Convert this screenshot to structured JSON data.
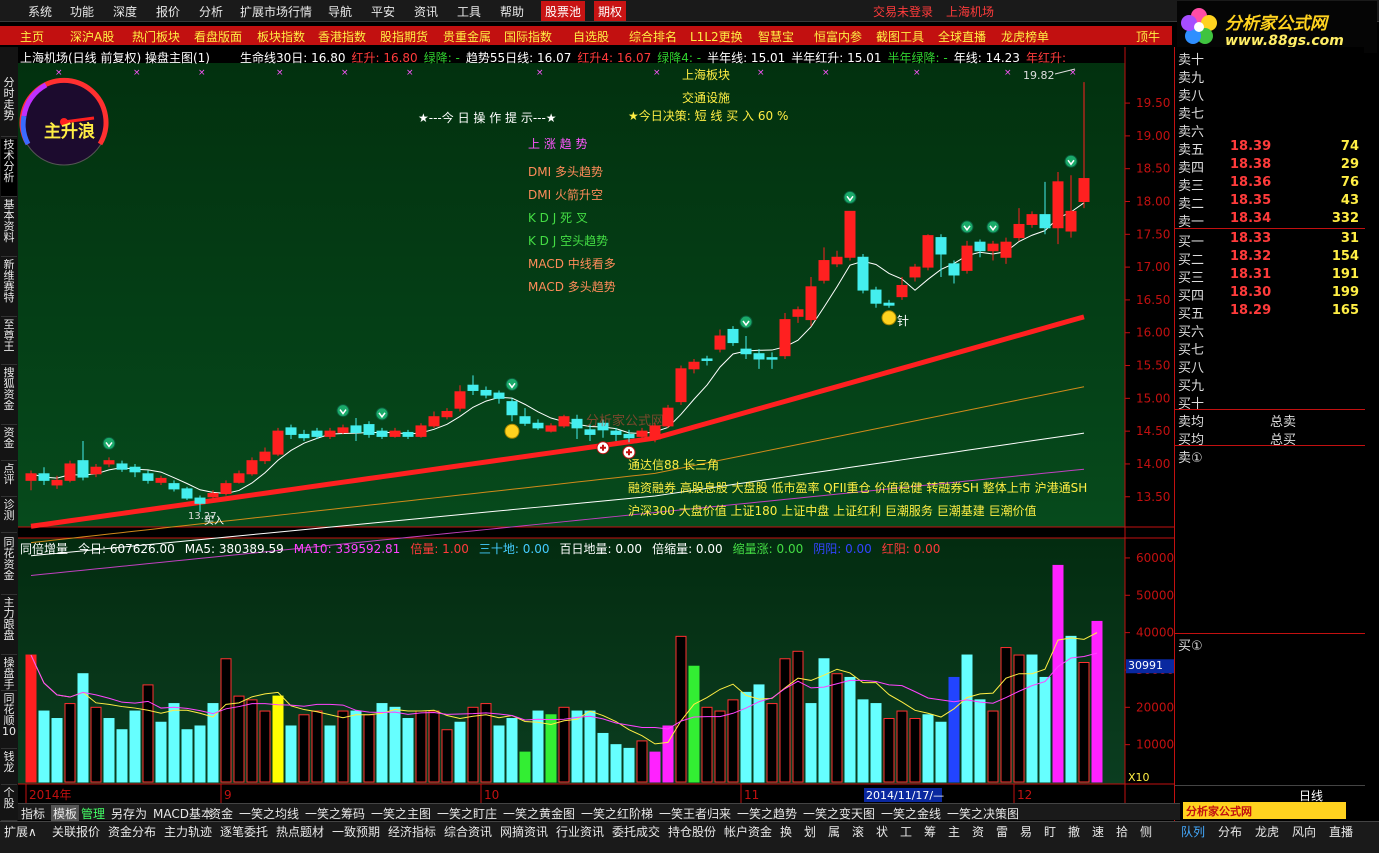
{
  "menu": {
    "items": [
      "系统",
      "功能",
      "深度",
      "报价",
      "分析",
      "扩展市场行情",
      "导航",
      "平安",
      "资讯",
      "工具",
      "帮助"
    ],
    "highlight1": "股票池",
    "highlight2": "期权",
    "status": "交易未登录",
    "stock_name": "上海机场"
  },
  "logo": {
    "line1": "分析家公式网",
    "line2": "www.88gs.com"
  },
  "navbar": {
    "items": [
      "主页",
      "深沪A股",
      "热门板块",
      "看盘版面",
      "板块指数",
      "香港指数",
      "股指期货",
      "贵重金属",
      "国际指数",
      "自选股",
      "综合排名",
      "L1L2更换",
      "智慧宝",
      "恒富内参",
      "截图工具",
      "全球直播",
      "龙虎榜单",
      "顶牛"
    ]
  },
  "left_tabs": [
    "分时走势",
    "技术分析",
    "基本资料",
    "新维赛特",
    "至尊王",
    "搜狐资金",
    "资金",
    "点评",
    "诊测",
    "同花资金",
    "主力跟盘",
    "操盘手",
    "同花顺10",
    "钱龙",
    "个股"
  ],
  "chart_header": {
    "title": "上海机场(日线 前复权) 操盘主图(1)",
    "lines": [
      {
        "label": "生命线30日: 16.80",
        "color": "#ffffff"
      },
      {
        "label": "红升: 16.80",
        "color": "#ff3b3b"
      },
      {
        "label": "绿降: -",
        "color": "#2fd22f"
      },
      {
        "label": "趋势55日线: 16.07",
        "color": "#ffffff"
      },
      {
        "label": "红升4: 16.07",
        "color": "#ff3b3b"
      },
      {
        "label": "绿降4: -",
        "color": "#2fd22f"
      },
      {
        "label": "半年线: 15.01",
        "color": "#ffffff"
      },
      {
        "label": "半年红升: 15.01",
        "color": "#ffffff"
      },
      {
        "label": "半年绿降: -",
        "color": "#2fd22f"
      },
      {
        "label": "年线: 14.23",
        "color": "#ffffff"
      },
      {
        "label": "年红升:",
        "color": "#ff3b3b"
      }
    ]
  },
  "gauge_label": "主升浪",
  "annotations": {
    "tip_title": "★---今 日 操 作 提 示---★",
    "sector_label": "上海板块",
    "sector_value": "交通设施",
    "decision": "★今日决策: 短 线 买 入 60 %",
    "trend_up": "上 涨 趋 势",
    "signals": [
      {
        "text": "DMI 多头趋势",
        "color": "#ff8c5a"
      },
      {
        "text": "DMI 火箭升空",
        "color": "#ff8c5a"
      },
      {
        "text": "K D J 死 叉",
        "color": "#44dd44"
      },
      {
        "text": "K D J 空头趋势",
        "color": "#44dd44"
      },
      {
        "text": "MACD 中线看多",
        "color": "#ff8c5a"
      },
      {
        "text": "MACD 多头趋势",
        "color": "#ff8c5a"
      }
    ],
    "concepts": [
      "通达信88 长三角",
      "融资融券 高股息股 大盘股 低市盈率 QFII重仓 价值稳健 转融券SH 整体上市 沪港通SH",
      "沪深300 大盘价值 上证180 上证中盘 上证红利 巨潮服务 巨潮基建 巨潮价值"
    ],
    "max_price": "19.82",
    "min_price": "13.27",
    "bottom_text": "买入",
    "needle_text": "针",
    "watermark": "分析家公式网"
  },
  "price_axis": [
    "19.50",
    "19.00",
    "18.50",
    "18.00",
    "17.50",
    "17.00",
    "16.50",
    "16.00",
    "15.50",
    "15.00",
    "14.50",
    "14.00",
    "13.50"
  ],
  "vol_header": {
    "items": [
      {
        "label": "同倍增量",
        "color": "#ffffff"
      },
      {
        "label": "今日: 607626.00",
        "color": "#ffffff"
      },
      {
        "label": "MA5: 380389.59",
        "color": "#ffffff"
      },
      {
        "label": "MA10: 339592.81",
        "color": "#ff44ff"
      },
      {
        "label": "倍量: 1.00",
        "color": "#ff3b3b"
      },
      {
        "label": "三十地: 0.00",
        "color": "#44ccff"
      },
      {
        "label": "百日地量: 0.00",
        "color": "#ffffff"
      },
      {
        "label": "倍缩量: 0.00",
        "color": "#ffffff"
      },
      {
        "label": "缩量涨: 0.00",
        "color": "#44dd44"
      },
      {
        "label": "阴阳: 0.00",
        "color": "#3344ff"
      },
      {
        "label": "红阳: 0.00",
        "color": "#ff3b3b"
      }
    ]
  },
  "vol_axis": [
    "60000",
    "50000",
    "40000",
    "30000",
    "20000",
    "10000"
  ],
  "vol_marker": "30991",
  "vol_scale": "X10",
  "date_axis": [
    "2014年",
    "9",
    "10",
    "11",
    "12"
  ],
  "date_highlight": "2014/11/17/—",
  "orderbook": {
    "sells": [
      {
        "label": "卖十",
        "price": "",
        "vol": ""
      },
      {
        "label": "卖九",
        "price": "",
        "vol": ""
      },
      {
        "label": "卖八",
        "price": "",
        "vol": ""
      },
      {
        "label": "卖七",
        "price": "",
        "vol": ""
      },
      {
        "label": "卖六",
        "price": "",
        "vol": ""
      },
      {
        "label": "卖五",
        "price": "18.39",
        "vol": "74"
      },
      {
        "label": "卖四",
        "price": "18.38",
        "vol": "29"
      },
      {
        "label": "卖三",
        "price": "18.36",
        "vol": "76"
      },
      {
        "label": "卖二",
        "price": "18.35",
        "vol": "43"
      },
      {
        "label": "卖一",
        "price": "18.34",
        "vol": "332"
      }
    ],
    "buys": [
      {
        "label": "买一",
        "price": "18.33",
        "vol": "31"
      },
      {
        "label": "买二",
        "price": "18.32",
        "vol": "154"
      },
      {
        "label": "买三",
        "price": "18.31",
        "vol": "191"
      },
      {
        "label": "买四",
        "price": "18.30",
        "vol": "199"
      },
      {
        "label": "买五",
        "price": "18.29",
        "vol": "165"
      },
      {
        "label": "买六",
        "price": "",
        "vol": ""
      },
      {
        "label": "买七",
        "price": "",
        "vol": ""
      },
      {
        "label": "买八",
        "price": "",
        "vol": ""
      },
      {
        "label": "买九",
        "price": "",
        "vol": ""
      },
      {
        "label": "买十",
        "price": "",
        "vol": ""
      }
    ],
    "avg_sell": "卖均",
    "total_sell": "总卖",
    "avg_buy": "买均",
    "total_buy": "总买",
    "sell_q": "卖①",
    "buy_q": "买①"
  },
  "period": "日线",
  "ad_bottom": "分析家公式网 www.88gs.com",
  "bottom_tabs1": [
    "指标",
    "模板",
    "管理",
    "另存为",
    "MACD基本",
    "资金",
    "一笑之均线",
    "一笑之筹码",
    "一笑之主图",
    "一笑之盯庄",
    "一笑之黄金图",
    "一笑之红阶梯",
    "一笑王者归来",
    "一笑之趋势",
    "一笑之变天图",
    "一笑之金线",
    "一笑之决策图"
  ],
  "bottom_tabs2": [
    "扩展∧",
    "关联报价",
    "资金分布",
    "主力轨迹",
    "逐笔委托",
    "热点题材",
    "一致预期",
    "经济指标",
    "综合资讯",
    "网摘资讯",
    "行业资讯",
    "委托成交",
    "持仓股份",
    "帐户资金",
    "换",
    "划",
    "属",
    "滚",
    "状",
    "工",
    "筹",
    "主",
    "资",
    "雷",
    "易",
    "盯",
    "撤",
    "速",
    "拾",
    "侧"
  ],
  "right_tabs": [
    "队列",
    "分布",
    "龙虎",
    "风向",
    "直播"
  ],
  "chart_data": {
    "type": "candlestick",
    "price_ylim": [
      13.1,
      20.05
    ],
    "vol_ylim": [
      0,
      64000
    ],
    "ma_lines": [
      "30日线",
      "55日线",
      "半年线",
      "年线"
    ],
    "candles": [
      [
        13.75,
        13.85,
        13.6,
        13.9
      ],
      [
        13.85,
        13.75,
        13.68,
        13.95
      ],
      [
        13.68,
        13.75,
        13.62,
        13.82
      ],
      [
        13.75,
        14.0,
        13.72,
        14.05
      ],
      [
        14.05,
        13.8,
        13.75,
        14.35
      ],
      [
        13.85,
        13.95,
        13.8,
        14.0
      ],
      [
        14.0,
        14.05,
        13.95,
        14.1
      ],
      [
        14.0,
        13.92,
        13.88,
        14.05
      ],
      [
        13.95,
        13.88,
        13.8,
        14.0
      ],
      [
        13.85,
        13.75,
        13.7,
        13.9
      ],
      [
        13.72,
        13.78,
        13.68,
        13.82
      ],
      [
        13.7,
        13.62,
        13.58,
        13.75
      ],
      [
        13.62,
        13.48,
        13.45,
        13.65
      ],
      [
        13.48,
        13.4,
        13.27,
        13.52
      ],
      [
        13.5,
        13.55,
        13.45,
        13.6
      ],
      [
        13.55,
        13.7,
        13.52,
        13.75
      ],
      [
        13.72,
        13.85,
        13.7,
        13.9
      ],
      [
        13.85,
        14.05,
        13.82,
        14.1
      ],
      [
        14.05,
        14.18,
        14.0,
        14.25
      ],
      [
        14.15,
        14.5,
        14.12,
        14.55
      ],
      [
        14.55,
        14.45,
        14.38,
        14.6
      ],
      [
        14.45,
        14.4,
        14.35,
        14.52
      ],
      [
        14.5,
        14.42,
        14.38,
        14.55
      ],
      [
        14.42,
        14.5,
        14.38,
        14.55
      ],
      [
        14.48,
        14.55,
        14.45,
        14.6
      ],
      [
        14.58,
        14.48,
        14.35,
        14.7
      ],
      [
        14.6,
        14.45,
        14.4,
        14.65
      ],
      [
        14.5,
        14.42,
        14.38,
        14.55
      ],
      [
        14.42,
        14.5,
        14.4,
        14.55
      ],
      [
        14.48,
        14.42,
        14.38,
        14.52
      ],
      [
        14.42,
        14.58,
        14.4,
        14.62
      ],
      [
        14.58,
        14.72,
        14.55,
        14.8
      ],
      [
        14.72,
        14.8,
        14.68,
        14.85
      ],
      [
        14.85,
        15.1,
        14.8,
        15.2
      ],
      [
        15.2,
        15.12,
        15.05,
        15.35
      ],
      [
        15.12,
        15.05,
        15.0,
        15.18
      ],
      [
        15.08,
        15.0,
        14.92,
        15.12
      ],
      [
        14.95,
        14.75,
        14.65,
        15.0
      ],
      [
        14.72,
        14.62,
        14.58,
        14.85
      ],
      [
        14.62,
        14.55,
        14.52,
        14.68
      ],
      [
        14.5,
        14.58,
        14.48,
        14.62
      ],
      [
        14.58,
        14.72,
        14.55,
        14.75
      ],
      [
        14.68,
        14.55,
        14.38,
        14.75
      ],
      [
        14.52,
        14.45,
        14.35,
        14.6
      ],
      [
        14.62,
        14.52,
        14.4,
        14.68
      ],
      [
        14.5,
        14.45,
        14.35,
        14.55
      ],
      [
        14.45,
        14.4,
        14.33,
        14.52
      ],
      [
        14.42,
        14.5,
        14.38,
        14.55
      ],
      [
        14.38,
        14.58,
        14.33,
        14.62
      ],
      [
        14.58,
        14.85,
        14.55,
        14.9
      ],
      [
        14.95,
        15.45,
        14.9,
        15.5
      ],
      [
        15.45,
        15.55,
        15.38,
        15.6
      ],
      [
        15.6,
        15.58,
        15.5,
        15.65
      ],
      [
        15.75,
        15.95,
        15.7,
        16.05
      ],
      [
        16.05,
        15.85,
        15.8,
        16.1
      ],
      [
        15.75,
        15.68,
        15.6,
        15.95
      ],
      [
        15.68,
        15.6,
        15.45,
        15.75
      ],
      [
        15.62,
        15.6,
        15.45,
        15.7
      ],
      [
        15.65,
        16.2,
        15.6,
        16.3
      ],
      [
        16.25,
        16.35,
        16.15,
        16.4
      ],
      [
        16.2,
        16.7,
        16.1,
        16.85
      ],
      [
        16.8,
        17.1,
        16.75,
        17.3
      ],
      [
        17.05,
        17.15,
        17.0,
        17.25
      ],
      [
        17.15,
        17.85,
        17.1,
        17.85
      ],
      [
        17.15,
        16.65,
        16.6,
        17.2
      ],
      [
        16.65,
        16.45,
        16.38,
        16.7
      ],
      [
        16.45,
        16.42,
        16.38,
        16.5
      ],
      [
        16.55,
        16.72,
        16.5,
        16.85
      ],
      [
        16.85,
        17.0,
        16.78,
        17.05
      ],
      [
        17.0,
        17.48,
        16.95,
        17.5
      ],
      [
        17.45,
        17.2,
        16.85,
        17.5
      ],
      [
        17.05,
        16.88,
        16.75,
        17.1
      ],
      [
        16.95,
        17.32,
        16.9,
        17.4
      ],
      [
        17.38,
        17.25,
        17.15,
        17.42
      ],
      [
        17.25,
        17.35,
        17.1,
        17.4
      ],
      [
        17.15,
        17.38,
        17.05,
        17.45
      ],
      [
        17.45,
        17.65,
        17.4,
        17.9
      ],
      [
        17.65,
        17.8,
        17.6,
        17.85
      ],
      [
        17.8,
        17.6,
        17.5,
        18.3
      ],
      [
        17.6,
        18.3,
        17.35,
        18.45
      ],
      [
        17.55,
        17.85,
        17.45,
        18.4
      ],
      [
        18.0,
        18.35,
        17.9,
        19.82
      ]
    ],
    "volumes": [
      34,
      19,
      17,
      21,
      29,
      20,
      17,
      14,
      19,
      26,
      16,
      21,
      14,
      15,
      21,
      33,
      23,
      22,
      19,
      23,
      15,
      18,
      19,
      15,
      19,
      19,
      18,
      21,
      20,
      17,
      19,
      19,
      14,
      16,
      20,
      21,
      15,
      17,
      8,
      19,
      18,
      20,
      19,
      19,
      13,
      10,
      9,
      11,
      8,
      15,
      39,
      31,
      20,
      19,
      22,
      24,
      26,
      21,
      33,
      35,
      21,
      33,
      29,
      28,
      22,
      21,
      17,
      19,
      17,
      18,
      16,
      28,
      34,
      22,
      19,
      36,
      34,
      34,
      28,
      58,
      39,
      32,
      43
    ],
    "volume_colors": [
      "#ff2020",
      "#66ffff",
      "#66ffff",
      "#000000",
      "#66ffff",
      "#000000",
      "#66ffff",
      "#66ffff",
      "#66ffff",
      "#000000",
      "#66ffff",
      "#66ffff",
      "#66ffff",
      "#66ffff",
      "#66ffff",
      "#000000",
      "#000000",
      "#000000",
      "#000000",
      "#ffff00",
      "#66ffff",
      "#000000",
      "#000000",
      "#66ffff",
      "#000000",
      "#66ffff",
      "#000000",
      "#66ffff",
      "#66ffff",
      "#66ffff",
      "#000000",
      "#000000",
      "#000000",
      "#66ffff",
      "#000000",
      "#000000",
      "#66ffff",
      "#66ffff",
      "#33ee33",
      "#66ffff",
      "#33ee33",
      "#000000",
      "#66ffff",
      "#66ffff",
      "#66ffff",
      "#66ffff",
      "#66ffff",
      "#000000",
      "#ff22ff",
      "#ff22ff",
      "#000000",
      "#33ee33",
      "#000000",
      "#000000",
      "#000000",
      "#66ffff",
      "#66ffff",
      "#000000",
      "#000000",
      "#000000",
      "#66ffff",
      "#66ffff",
      "#000000",
      "#66ffff",
      "#66ffff",
      "#66ffff",
      "#000000",
      "#000000",
      "#000000",
      "#66ffff",
      "#66ffff",
      "#2244ff",
      "#66ffff",
      "#66ffff",
      "#000000",
      "#000000",
      "#000000",
      "#66ffff",
      "#66ffff",
      "#ff22ff",
      "#66ffff",
      "#000000",
      "#ff22ff"
    ]
  }
}
